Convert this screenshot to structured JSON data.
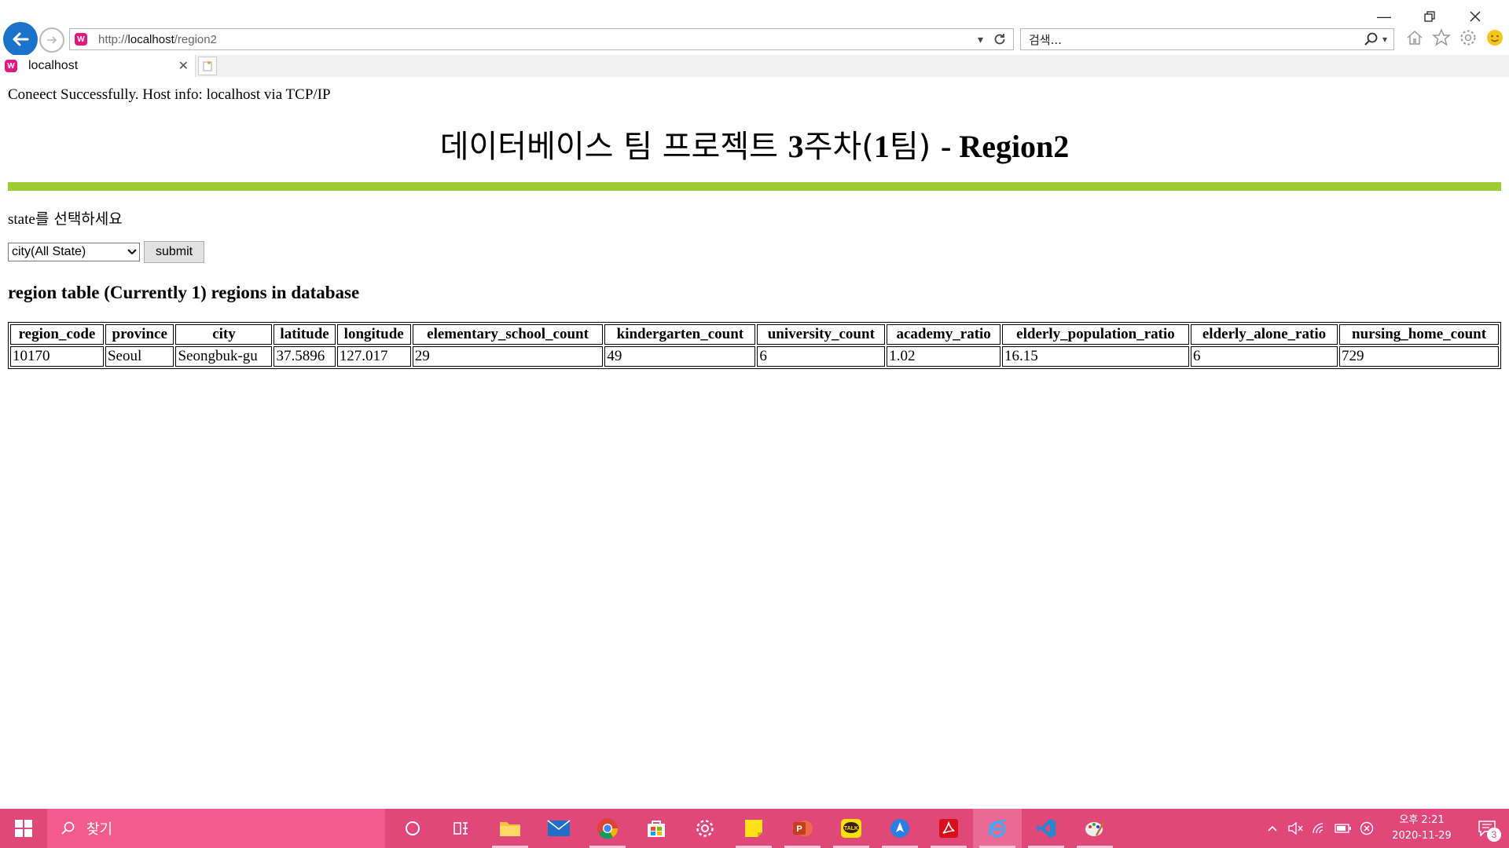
{
  "browser": {
    "url_prefix": "http://",
    "url_host": "localhost",
    "url_path": "/region2",
    "search_placeholder": "검색...",
    "tab_title": "localhost"
  },
  "page": {
    "connection_message": "Coneect Successfully. Host info: localhost via TCP/IP",
    "title_ko": "데이터베이스 팀 프로젝트 ",
    "title_mid": "3",
    "title_ko2": "주차(",
    "title_num": "1",
    "title_ko3": "팀) ",
    "title_en": "- Region2",
    "accent_color": "#9acd32",
    "state_label_en": "state",
    "state_label_ko": "를 선택하세요",
    "select_value": "city(All State)",
    "submit_label": "submit",
    "table_heading": "region table (Currently 1) regions in database"
  },
  "table": {
    "columns": [
      "region_code",
      "province",
      "city",
      "latitude",
      "longitude",
      "elementary_school_count",
      "kindergarten_count",
      "university_count",
      "academy_ratio",
      "elderly_population_ratio",
      "elderly_alone_ratio",
      "nursing_home_count"
    ],
    "rows": [
      [
        "10170",
        "Seoul",
        "Seongbuk-gu",
        "37.5896",
        "127.017",
        "29",
        "49",
        "6",
        "1.02",
        "16.15",
        "6",
        "729"
      ]
    ]
  },
  "taskbar": {
    "search_text": "찾기",
    "clock_period": "오후 2:21",
    "clock_date": "2020-11-29",
    "notification_count": "3",
    "color": "#e0487a"
  }
}
